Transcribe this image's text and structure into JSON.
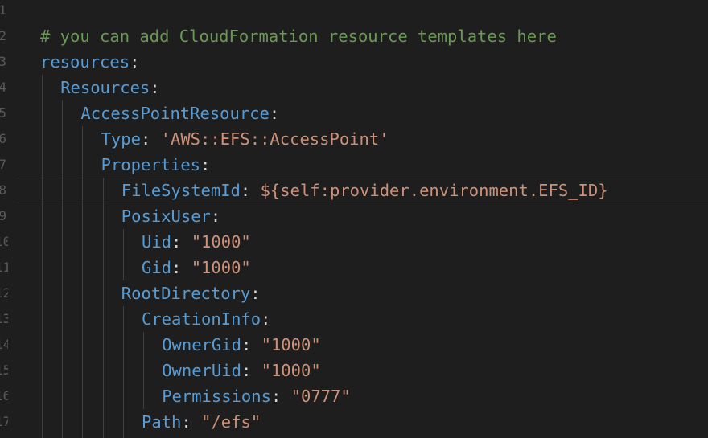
{
  "line_numbers": [
    "1",
    "2",
    "3",
    "4",
    "5",
    "6",
    "7",
    "8",
    "9",
    "10",
    "11",
    "12",
    "13",
    "14",
    "15",
    "16",
    "17"
  ],
  "lines": [
    {
      "key": "# you can add CloudFormation resource templates here",
      "kind": "comment",
      "indent": 0
    },
    {
      "key": "resources",
      "sep": ":",
      "value": "",
      "indent": 0
    },
    {
      "key": "Resources",
      "sep": ":",
      "value": "",
      "indent": 1
    },
    {
      "key": "AccessPointResource",
      "sep": ":",
      "value": "",
      "indent": 2
    },
    {
      "key": "Type",
      "sep": ": ",
      "value": "'AWS::EFS::AccessPoint'",
      "indent": 3
    },
    {
      "key": "Properties",
      "sep": ":",
      "value": "",
      "indent": 3
    },
    {
      "key": "FileSystemId",
      "sep": ": ",
      "value": "${self:provider.environment.EFS_ID}",
      "indent": 4
    },
    {
      "key": "PosixUser",
      "sep": ":",
      "value": "",
      "indent": 4
    },
    {
      "key": "Uid",
      "sep": ": ",
      "value": "\"1000\"",
      "indent": 5
    },
    {
      "key": "Gid",
      "sep": ": ",
      "value": "\"1000\"",
      "indent": 5
    },
    {
      "key": "RootDirectory",
      "sep": ":",
      "value": "",
      "indent": 4
    },
    {
      "key": "CreationInfo",
      "sep": ":",
      "value": "",
      "indent": 5
    },
    {
      "key": "OwnerGid",
      "sep": ": ",
      "value": "\"1000\"",
      "indent": 6
    },
    {
      "key": "OwnerUid",
      "sep": ": ",
      "value": "\"1000\"",
      "indent": 6
    },
    {
      "key": "Permissions",
      "sep": ": ",
      "value": "\"0777\"",
      "indent": 6
    },
    {
      "key": "Path",
      "sep": ": ",
      "value": "\"/efs\"",
      "indent": 5
    }
  ],
  "colors": {
    "background": "#1e1e1e",
    "comment": "#6a9955",
    "key": "#569cd6",
    "string": "#ce9178",
    "punctuation": "#d4d4d4",
    "line_number": "#5a5a5a",
    "indent_guide": "#404040"
  }
}
